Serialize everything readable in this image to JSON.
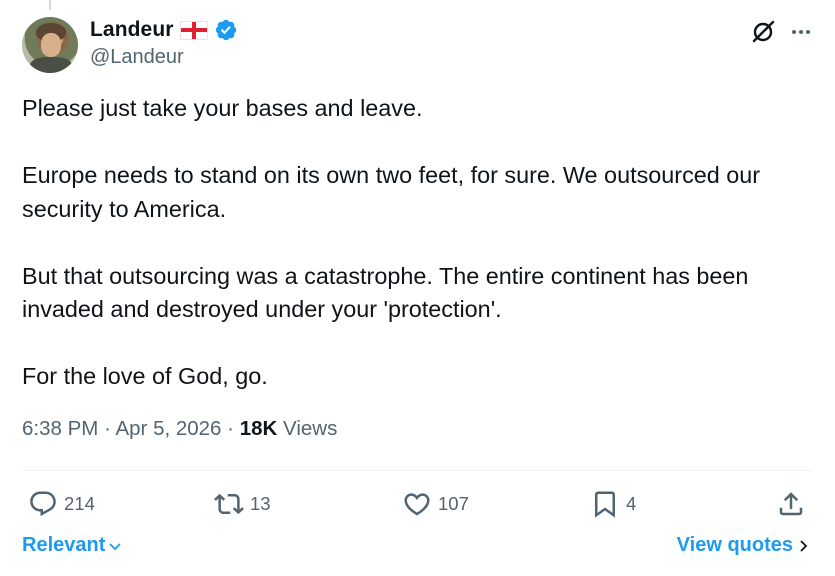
{
  "user": {
    "display_name": "Landeur",
    "handle": "@Landeur"
  },
  "tweet": {
    "paragraphs": [
      "Please just take your bases and leave.",
      "Europe needs to stand on its own two feet, for sure. We outsourced our security to America.",
      "But that outsourcing was a catastrophe. The entire continent has been invaded and destroyed under your 'protection'.",
      "For the love of God, go."
    ],
    "time": "6:38 PM",
    "separator": "·",
    "date": "Apr 5, 2026",
    "views_count": "18K",
    "views_label": "Views"
  },
  "actions": {
    "replies": "214",
    "reposts": "13",
    "likes": "107",
    "bookmarks": "4"
  },
  "footer": {
    "sort_label": "Relevant",
    "quotes_label": "View quotes"
  },
  "colors": {
    "accent": "#1d9bf0",
    "muted": "#536471",
    "text": "#0f1419"
  }
}
